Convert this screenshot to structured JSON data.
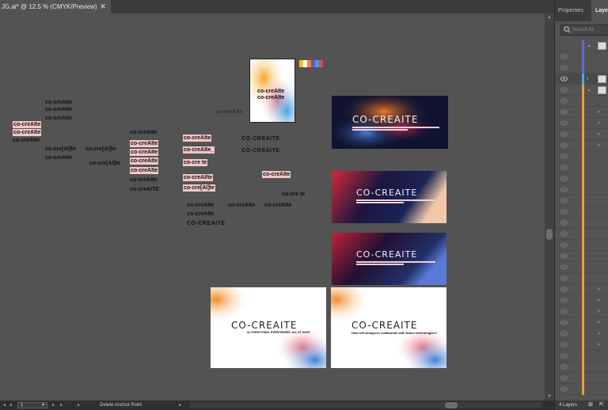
{
  "document": {
    "tab_title": "JG.ai* @ 12.5 % (CMYK/Preview)",
    "close_glyph": "✕"
  },
  "panel": {
    "tabs": [
      "Properties",
      "Layers"
    ],
    "search_placeholder": "Search All",
    "footer_text": "4 Layers",
    "colors": {
      "accent_blue": "#5b6bd6",
      "accent_orange": "#e8a03a",
      "accent_cyan": "#3fb0d8"
    }
  },
  "status": {
    "page_number": "1",
    "tool_name": "Delete Anchor Point"
  },
  "canvas": {
    "loose_texts": [
      "co-creAIte",
      "co-creAIte",
      "co-creAIte",
      "co-creAIte",
      "co-creAIte",
      "co-creAIte",
      "co-cre[AI]te",
      "co-cre[AI]te",
      "co-creAIte",
      "co-cre[AI]te",
      "co-creAIte",
      "co-creAIte",
      "co-creAIte",
      "co-creAIte",
      "co-creAIte",
      "co-creAIte",
      "co-creAITE",
      "co-creAIte",
      "co-creAIte_",
      "co-cre  te",
      "co-creAI/te",
      "co-cre[AI]te",
      "co-creAIte",
      "CO-CREAITE",
      "CO-CREAITE",
      "co-creAIte",
      "co-cre   te",
      "co-creAIte",
      "co-creAIte",
      "co-creAIte",
      "co-creAIte",
      "CO-CREAITE"
    ],
    "poster_title_1": "co-creAIte",
    "poster_title_2": "co-creAIte",
    "poster_label": "co-creAIte",
    "brand_dark_1": "CO-CREAITE",
    "brand_dark_2": "CO-CREAITE",
    "brand_dark_3": "CO-CREAITE",
    "brand_light_1": "CO-CREAITE",
    "brand_light_2": "CO-CREAITE",
    "tagline_1": "AI, EVERYTHING, EVERYWHERE, ALL AT ONCE",
    "tagline_2": "How will designers collaborate with future technologies?"
  }
}
